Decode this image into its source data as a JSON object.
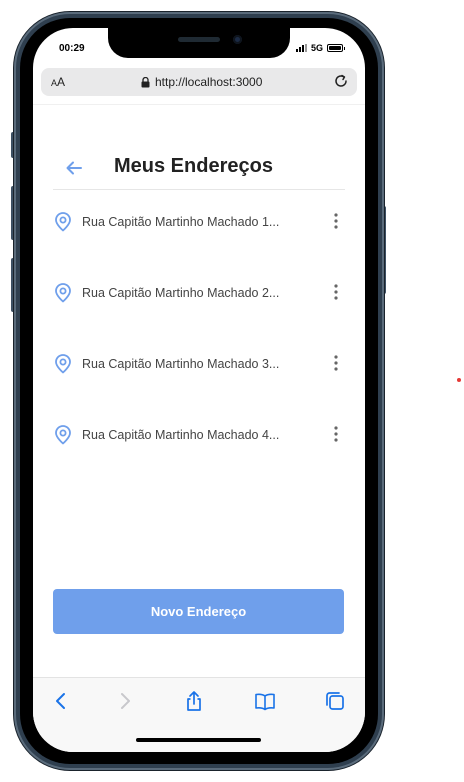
{
  "status_bar": {
    "time": "00:29",
    "network": "5G"
  },
  "browser": {
    "text_size_label_small": "A",
    "text_size_label_large": "A",
    "url": "http://localhost:3000"
  },
  "header": {
    "title": "Meus Endereços"
  },
  "addresses": [
    {
      "label": "Rua Capitão Martinho Machado 1..."
    },
    {
      "label": "Rua Capitão Martinho Machado 2..."
    },
    {
      "label": "Rua Capitão Martinho Machado 3..."
    },
    {
      "label": "Rua Capitão Martinho Machado 4..."
    }
  ],
  "actions": {
    "new_address_label": "Novo Endereço"
  },
  "colors": {
    "accent": "#6f9feb",
    "pin_icon": "#6f9feb",
    "safari_blue": "#1a73e8"
  },
  "icons": {
    "back": "arrow-left-icon",
    "address": "map-pin-icon",
    "more": "kebab-menu-icon",
    "lock": "lock-icon",
    "reload": "reload-icon",
    "toolbar": [
      "chevron-left-icon",
      "chevron-right-icon",
      "share-icon",
      "book-icon",
      "tabs-icon"
    ]
  }
}
